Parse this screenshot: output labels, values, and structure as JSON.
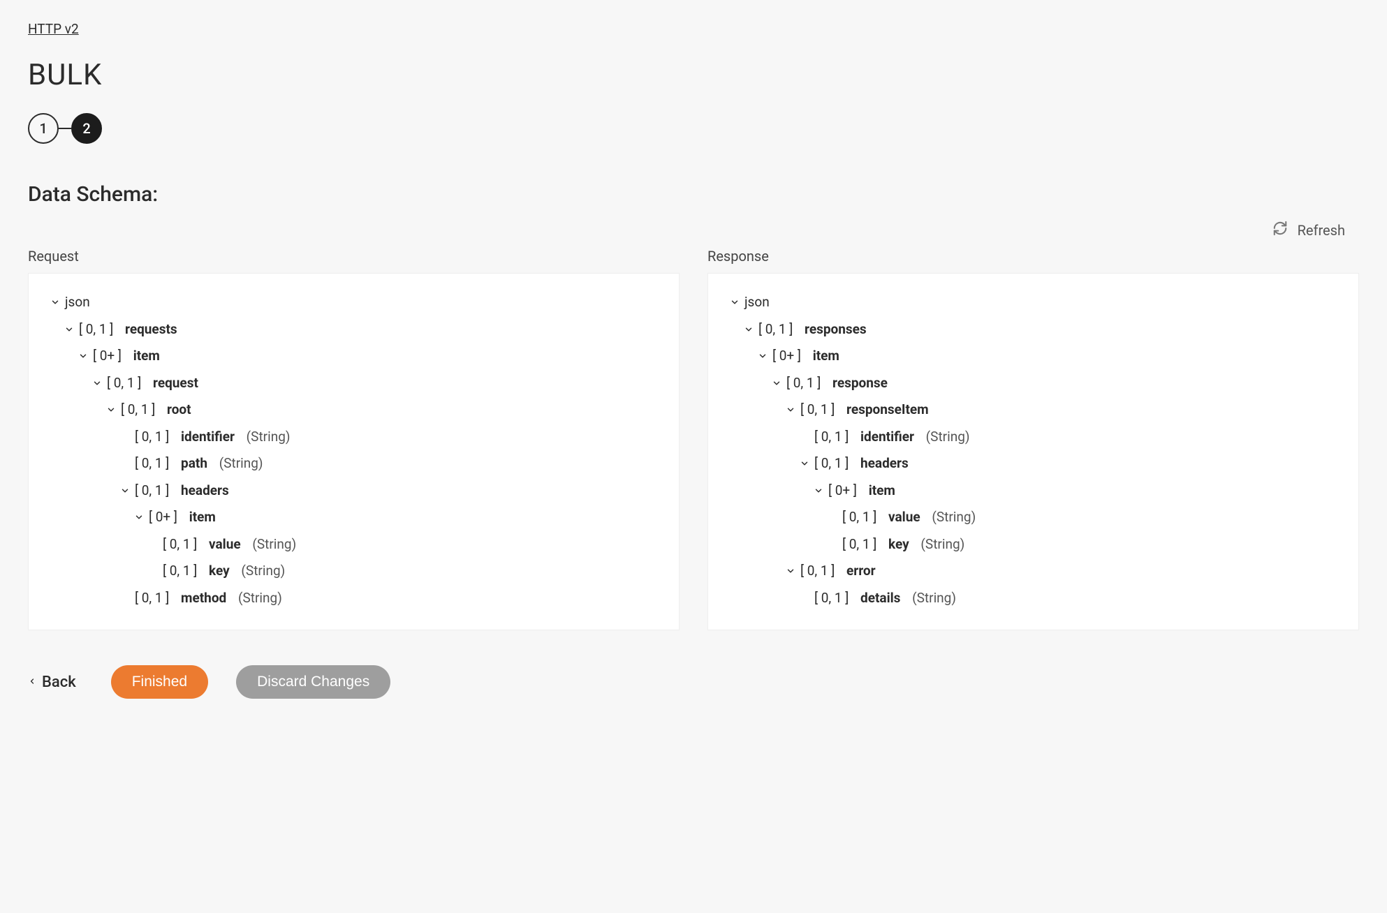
{
  "breadcrumb": "HTTP  v2",
  "title": "BULK",
  "stepper": {
    "step1": "1",
    "step2": "2"
  },
  "section_heading": "Data Schema:",
  "refresh_label": "Refresh",
  "columns": {
    "request": {
      "label": "Request"
    },
    "response": {
      "label": "Response"
    }
  },
  "request_tree": {
    "root": "json",
    "n1_card": "[ 0, 1 ]",
    "n1_name": "requests",
    "n2_card": "[ 0+ ]",
    "n2_name": "item",
    "n3_card": "[ 0, 1 ]",
    "n3_name": "request",
    "n4_card": "[ 0, 1 ]",
    "n4_name": "root",
    "n5_card": "[ 0, 1 ]",
    "n5_name": "identifier",
    "n5_type": "(String)",
    "n6_card": "[ 0, 1 ]",
    "n6_name": "path",
    "n6_type": "(String)",
    "n7_card": "[ 0, 1 ]",
    "n7_name": "headers",
    "n8_card": "[ 0+ ]",
    "n8_name": "item",
    "n9_card": "[ 0, 1 ]",
    "n9_name": "value",
    "n9_type": "(String)",
    "n10_card": "[ 0, 1 ]",
    "n10_name": "key",
    "n10_type": "(String)",
    "n11_card": "[ 0, 1 ]",
    "n11_name": "method",
    "n11_type": "(String)"
  },
  "response_tree": {
    "root": "json",
    "n1_card": "[ 0, 1 ]",
    "n1_name": "responses",
    "n2_card": "[ 0+ ]",
    "n2_name": "item",
    "n3_card": "[ 0, 1 ]",
    "n3_name": "response",
    "n4_card": "[ 0, 1 ]",
    "n4_name": "responseItem",
    "n5_card": "[ 0, 1 ]",
    "n5_name": "identifier",
    "n5_type": "(String)",
    "n6_card": "[ 0, 1 ]",
    "n6_name": "headers",
    "n7_card": "[ 0+ ]",
    "n7_name": "item",
    "n8_card": "[ 0, 1 ]",
    "n8_name": "value",
    "n8_type": "(String)",
    "n9_card": "[ 0, 1 ]",
    "n9_name": "key",
    "n9_type": "(String)",
    "n10_card": "[ 0, 1 ]",
    "n10_name": "error",
    "n11_card": "[ 0, 1 ]",
    "n11_name": "details",
    "n11_type": "(String)"
  },
  "footer": {
    "back": "Back",
    "finished": "Finished",
    "discard": "Discard Changes"
  }
}
